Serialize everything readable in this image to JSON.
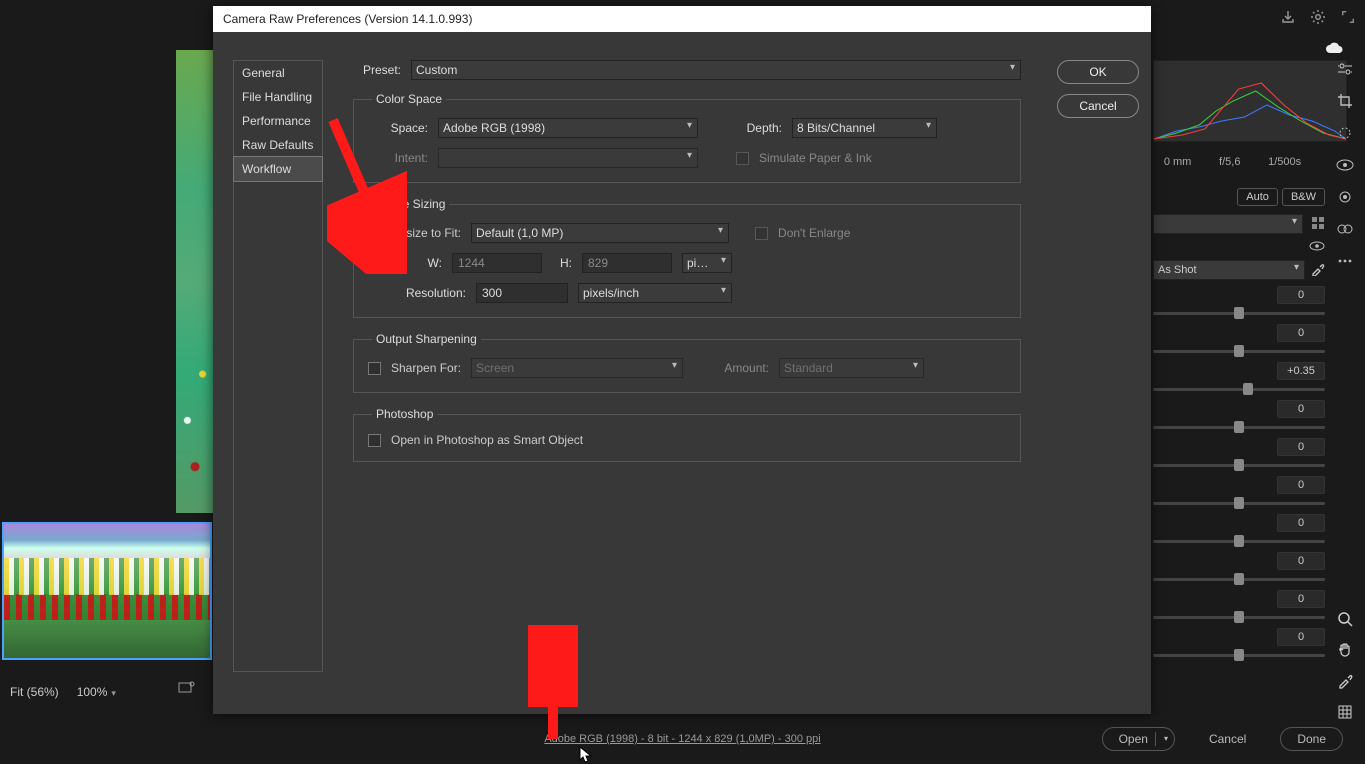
{
  "app": {
    "cloud_icon": "cloud"
  },
  "meta": {
    "focal": "0 mm",
    "aperture": "f/5,6",
    "shutter": "1/500s"
  },
  "edit": {
    "auto_label": "Auto",
    "bw_label": "B&W",
    "wb_label": "As Shot",
    "sliders": [
      {
        "value": "0",
        "pos": 50
      },
      {
        "value": "0",
        "pos": 50
      },
      {
        "value": "+0.35",
        "pos": 55
      },
      {
        "value": "0",
        "pos": 50
      },
      {
        "value": "0",
        "pos": 50
      },
      {
        "value": "0",
        "pos": 50
      },
      {
        "value": "0",
        "pos": 50
      },
      {
        "value": "0",
        "pos": 50
      },
      {
        "value": "0",
        "pos": 50
      },
      {
        "value": "0",
        "pos": 50
      }
    ]
  },
  "zoom": {
    "fit": "Fit (56%)",
    "pct": "100%"
  },
  "bottom": {
    "link": "Adobe RGB (1998) - 8 bit - 1244 x 829 (1,0MP) - 300 ppi",
    "open": "Open",
    "cancel": "Cancel",
    "done": "Done"
  },
  "dialog": {
    "title": "Camera Raw Preferences  (Version 14.1.0.993)",
    "tabs": {
      "general": "General",
      "file": "File Handling",
      "perf": "Performance",
      "raw": "Raw Defaults",
      "workflow": "Workflow"
    },
    "ok": "OK",
    "cancel": "Cancel",
    "preset_lbl": "Preset:",
    "preset_val": "Custom",
    "grp_color": "Color Space",
    "space_lbl": "Space:",
    "space_val": "Adobe RGB (1998)",
    "depth_lbl": "Depth:",
    "depth_val": "8 Bits/Channel",
    "intent_lbl": "Intent:",
    "sim_lbl": "Simulate Paper & Ink",
    "grp_size": "Image Sizing",
    "resize_lbl": "Resize to Fit:",
    "resize_val": "Default  (1,0 MP)",
    "dont_enlarge": "Don't Enlarge",
    "w_lbl": "W:",
    "w_val": "1244",
    "h_lbl": "H:",
    "h_val": "829",
    "unit_val": "pi…",
    "res_lbl": "Resolution:",
    "res_val": "300",
    "res_unit": "pixels/inch",
    "grp_sharp": "Output Sharpening",
    "sharpen_lbl": "Sharpen For:",
    "sharpen_val": "Screen",
    "amount_lbl": "Amount:",
    "amount_val": "Standard",
    "grp_ps": "Photoshop",
    "smart_lbl": "Open in Photoshop as Smart Object"
  }
}
